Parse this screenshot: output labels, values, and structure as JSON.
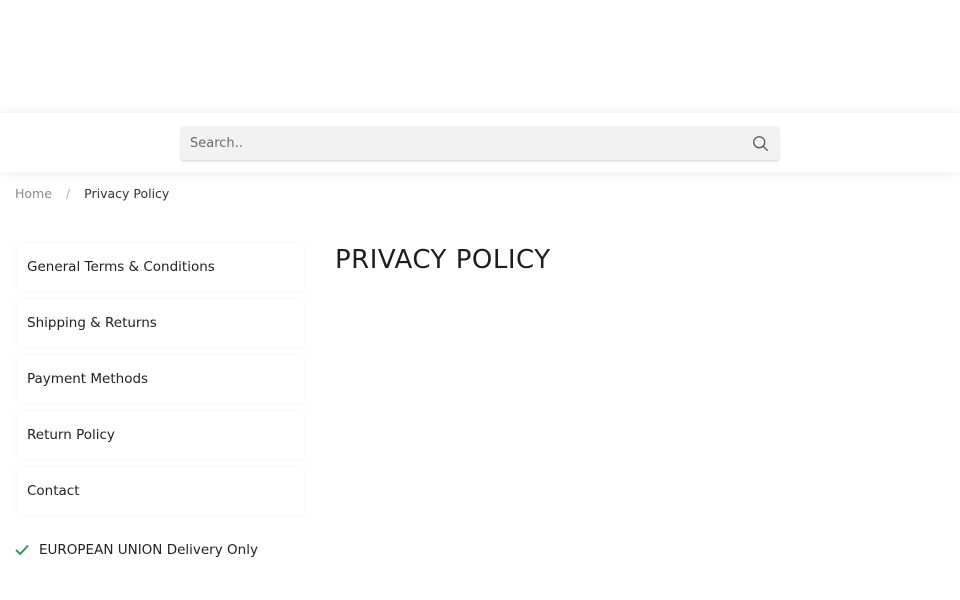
{
  "search": {
    "placeholder": "Search.."
  },
  "breadcrumb": {
    "home": "Home",
    "separator": "/",
    "current": "Privacy Policy"
  },
  "sidebar": {
    "items": [
      {
        "label": "General Terms & Conditions"
      },
      {
        "label": "Shipping & Returns"
      },
      {
        "label": "Payment Methods"
      },
      {
        "label": "Return Policy"
      },
      {
        "label": "Contact"
      }
    ]
  },
  "delivery": {
    "text": "EUROPEAN UNION Delivery Only",
    "icon": "check-icon",
    "icon_color": "#2e9e4f"
  },
  "main": {
    "title": "PRIVACY POLICY"
  }
}
